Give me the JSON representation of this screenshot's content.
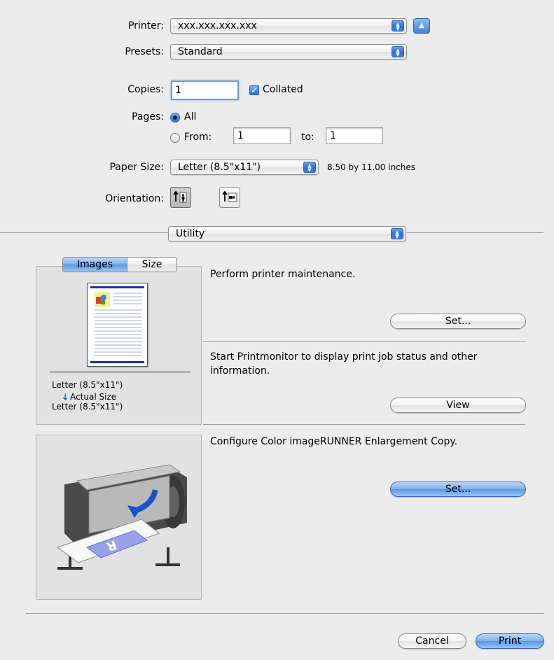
{
  "printer": {
    "label": "Printer:",
    "value": "xxx.xxx.xxx.xxx"
  },
  "presets": {
    "label": "Presets:",
    "value": "Standard"
  },
  "copies": {
    "label": "Copies:",
    "value": "1",
    "collated_label": "Collated"
  },
  "pages": {
    "label": "Pages:",
    "all_label": "All",
    "from_label": "From:",
    "from_value": "1",
    "to_label": "to:",
    "to_value": "1",
    "selected": "All"
  },
  "paper_size": {
    "label": "Paper Size:",
    "value": "Letter (8.5\"x11\")",
    "dimensions": "8.50 by 11.00 inches"
  },
  "orientation": {
    "label": "Orientation:",
    "options": [
      "portrait-icon",
      "landscape-icon"
    ],
    "selected": "portrait-icon"
  },
  "section_popup": {
    "value": "Utility"
  },
  "preview": {
    "tabs": [
      "Images",
      "Size"
    ],
    "active_tab": "Images",
    "source_size": "Letter (8.5\"x11\")",
    "scale": "Actual Size",
    "output_size": "Letter (8.5\"x11\")"
  },
  "utility": {
    "maintenance_text": "Perform printer maintenance.",
    "maintenance_button": "Set...",
    "monitor_text": "Start Printmonitor to display print job status and other information.",
    "monitor_button": "View",
    "enlarge_text": "Configure Color imageRUNNER Enlargement Copy.",
    "enlarge_button": "Set..."
  },
  "footer": {
    "cancel": "Cancel",
    "print": "Print"
  },
  "colors": {
    "accent": "#3d82de",
    "panel": "#e2e2e2"
  }
}
